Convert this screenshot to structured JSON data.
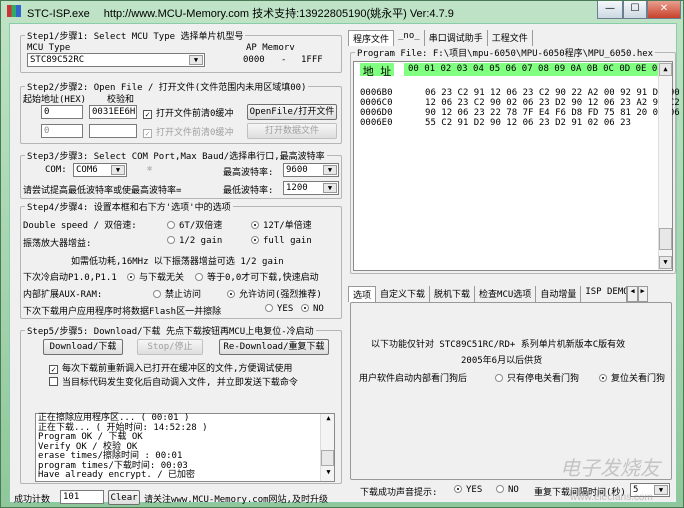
{
  "window": {
    "title_parts": [
      "STC-ISP.exe",
      "http://www.MCU-Memory.com 技术支持:13922805190(姚永平) Ver:4.7.9"
    ],
    "controls": [
      "—",
      "☐",
      "✕"
    ]
  },
  "step1": {
    "legend": "Step1/步骤1: Select MCU Type  选择单片机型号",
    "mcu_type_label": "MCU Type",
    "mcu_type_value": "STC89C52RC",
    "ap_memory_label": "AP Memorv",
    "ap_from": "0000",
    "ap_dash": "-",
    "ap_to": "1FFF"
  },
  "step2": {
    "legend": "Step2/步骤2: Open File / 打开文件(文件范围内未用区域填00)",
    "addr_label": "起始地址(HEX)",
    "checksum_label": "校验和",
    "addr1": "0",
    "checksum1": "0031EE6H",
    "clear_label1": "打开文件前清0缓冲",
    "open_file": "OpenFile/打开文件",
    "addr2": "0",
    "checksum2": "",
    "clear_label2": "打开文件前清0缓冲",
    "open_data": "打开数据文件"
  },
  "step3": {
    "legend": "Step3/步骤3: Select COM Port,Max Baud/选择串行口,最高波特率",
    "com_label": "COM:",
    "com_value": "COM6",
    "max_baud_label": "最高波特率:",
    "max_baud": "9600",
    "hint": "请尝试提高最低波特率或使最高波特率=",
    "min_baud_label": "最低波特率:",
    "min_baud": "1200"
  },
  "step4": {
    "legend": "Step4/步骤4: 设置本框和右下方'选项'中的选项",
    "double_speed_label": "Double speed / 双倍速:",
    "ds_opt1": "6T/双倍速",
    "ds_opt2": "12T/单倍速",
    "ds_selected": "12T/单倍速",
    "osc_label": "振荡放大器增益:",
    "osc_opt1": "1/2 gain",
    "osc_opt2": "full gain",
    "osc_selected": "full gain",
    "osc_hint": "如需低功耗,16MHz 以下振荡器增益可选 1/2 gain",
    "cold_label": "下次冷启动P1.0,P1.1",
    "cold_opt1": "与下载无关",
    "cold_opt2": "等于0,0才可下载,快速启动",
    "cold_selected": "与下载无关",
    "aux_label": "内部扩展AUX-RAM:",
    "aux_opt1": "禁止访问",
    "aux_opt2": "允许访问(强烈推荐)",
    "aux_selected": "允许访问(强烈推荐)",
    "erase_label": "下次下载用户应用程序时将数据Flash区一并擦除",
    "erase_opt1": "YES",
    "erase_opt2": "NO",
    "erase_selected": "NO"
  },
  "step5": {
    "legend": "Step5/步骤5: Download/下载  先点下载按钮再MCU上电复位-冷启动",
    "download": "Download/下载",
    "stop": "Stop/停止",
    "redownload": "Re-Download/重复下载",
    "chk1": {
      "label": "每次下载前重新调入已打开在缓冲区的文件,方便调试使用",
      "checked": true
    },
    "chk2": {
      "label": "当目标代码发生变化后自动调入文件, 并立即发送下载命令",
      "checked": false
    },
    "log": [
      "正在擦除应用程序区... ( 00:01 )",
      "正在下载... ( 开始时间: 14:52:28 )",
      "Program OK / 下载 OK",
      "Verify  OK / 校验 OK",
      "erase times/擦除时间 :  00:01",
      "program times/下载时间: 00:03",
      "Have already encrypt. / 已加密"
    ]
  },
  "status": {
    "count_label": "成功计数",
    "count": "101",
    "clear": "Clear",
    "notice": "请关注www.MCU-Memory.com网站,及时升级"
  },
  "right_tabs": [
    "程序文件",
    "_no_",
    "串口调试助手",
    "工程文件"
  ],
  "program": {
    "legend": "Program File: F:\\项目\\mpu-6050\\MPU-6050程序\\MPU_6050.hex",
    "addr_header": "地 址",
    "col_header": "00 01 02 03 04 05 06 07 08 09 0A 0B 0C 0D 0E 0F",
    "rows": [
      {
        "addr": "0006B0",
        "bytes": "06 23 C2 91 12 06 23 C2 90 22 A2 00 92 91 D2 90"
      },
      {
        "addr": "0006C0",
        "bytes": "12 06 23 C2 90 02 06 23 D2 90 12 06 23 A2 91 C2"
      },
      {
        "addr": "0006D0",
        "bytes": "90 12 06 23 22 78 7F E4 F6 D8 FD 75 81 20 02 06"
      },
      {
        "addr": "0006E0",
        "bytes": "55 C2 91 D2 90 12 06 23 D2 91 02 06 23"
      }
    ],
    "header_color": "#80ff80"
  },
  "option_tabs": [
    "选项",
    "自定义下载",
    "脱机下载",
    "检查MCU选项",
    "自动增量",
    "ISP DEMO"
  ],
  "options": {
    "line1": "以下功能仅针对 STC89C51RC/RD+ 系列单片机新版本C版有效",
    "line2": "2005年6月以后供货",
    "wdt_label": "用户软件启动内部看门狗后",
    "wdt_opt1": "只有停电关看门狗",
    "wdt_opt2": "复位关看门狗",
    "wdt_selected": "复位关看门狗",
    "sound_label": "下载成功声音提示:",
    "sound_opt1": "YES",
    "sound_opt2": "NO",
    "sound_selected": "YES",
    "interval_label": "重复下载间隔时间(秒)",
    "interval": "5"
  },
  "watermark": {
    "text": "电子发烧友",
    "url": "www.elecfans.com"
  }
}
